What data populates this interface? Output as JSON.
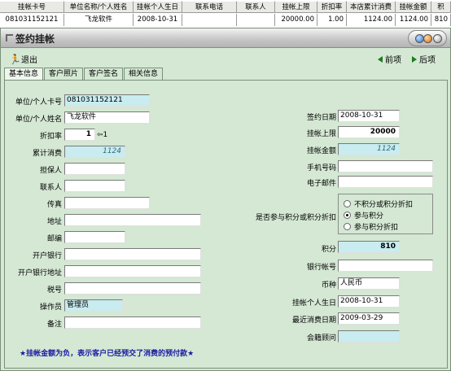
{
  "grid": {
    "columns": [
      "挂帐卡号",
      "单位名称/个人姓名",
      "挂帐个人生日",
      "联系电话",
      "联系人",
      "挂帐上限",
      "折扣率",
      "本店累计消费",
      "挂帐金额",
      "积"
    ],
    "row": [
      "081031152121",
      "飞龙软件",
      "2008-10-31",
      "",
      "",
      "20000.00",
      "1.00",
      "1124.00",
      "1124.00",
      "810"
    ]
  },
  "window": {
    "title": "签约挂帐"
  },
  "toolbar": {
    "exit_label": "退出",
    "prev_label": "前项",
    "next_label": "后项"
  },
  "tabs": [
    "基本信息",
    "客户照片",
    "客户签名",
    "相关信息"
  ],
  "form": {
    "card_no_label": "单位/个人卡号",
    "card_no": "081031152121",
    "name_label": "单位/个人姓名",
    "name": "飞龙软件",
    "discount_label": "折扣率",
    "discount": "1",
    "discount_hint": "⇦1",
    "total_consume_label": "累计消费",
    "total_consume": "1124",
    "guarantor_label": "担保人",
    "guarantor": "",
    "contact_label": "联系人",
    "contact": "",
    "fax_label": "传真",
    "fax": "",
    "address_label": "地址",
    "address": "",
    "postcode_label": "邮编",
    "postcode": "",
    "bank_label": "开户银行",
    "bank": "",
    "bank_address_label": "开户银行地址",
    "bank_address": "",
    "tax_no_label": "税号",
    "tax_no": "",
    "operator_label": "操作员",
    "operator": "管理员",
    "remark_label": "备注",
    "remark": "",
    "sign_date_label": "签约日期",
    "sign_date": "2008-10-31",
    "credit_limit_label": "挂帐上限",
    "credit_limit": "20000",
    "charge_amount_label": "挂帐金额",
    "charge_amount": "1124",
    "mobile_label": "手机号码",
    "mobile": "",
    "email_label": "电子邮件",
    "email": "",
    "points_option_label": "是否参与积分或积分折扣",
    "points_options": [
      "不积分或积分折扣",
      "参与积分",
      "参与积分折扣"
    ],
    "points_selected": "参与积分",
    "points_label": "积分",
    "points": "810",
    "bank_account_label": "银行帐号",
    "bank_account": "",
    "currency_label": "币种",
    "currency": "人民币",
    "birthday_label": "挂帐个人生日",
    "birthday": "2008-10-31",
    "last_consume_label": "最近消费日期",
    "last_consume": "2009-03-29",
    "advisor_label": "会籍顾问",
    "advisor": ""
  },
  "note": "★挂帐金额为负，表示客户已经预交了消费的预付款★"
}
